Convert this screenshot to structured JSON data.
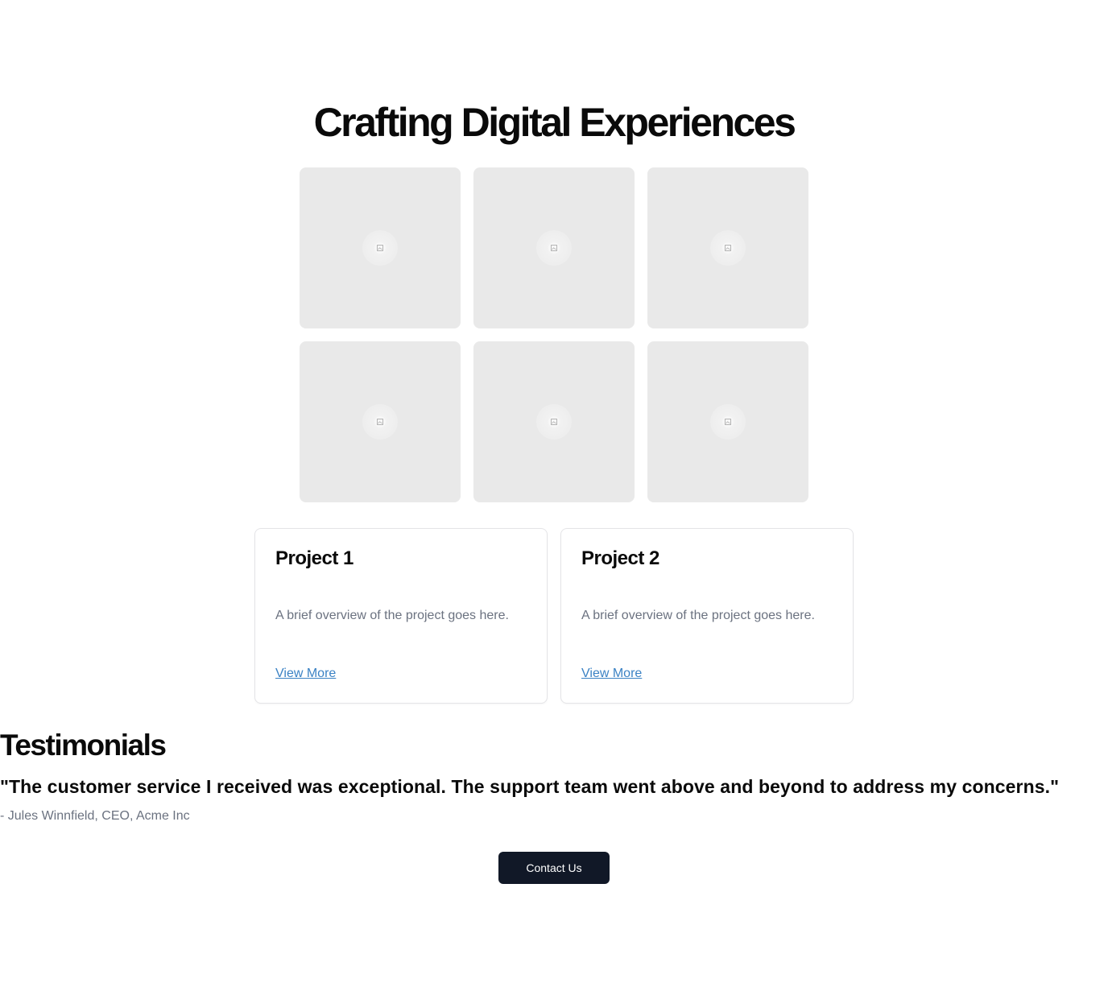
{
  "hero": {
    "title": "Crafting Digital Experiences"
  },
  "gallery": {
    "image_icon": "image-placeholder-icon",
    "tile_color": "#e9e9e9",
    "tile_count": 6
  },
  "projects": [
    {
      "title": "Project 1",
      "description": "A brief overview of the project goes here.",
      "link_label": "View More"
    },
    {
      "title": "Project 2",
      "description": "A brief overview of the project goes here.",
      "link_label": "View More"
    }
  ],
  "testimonials": {
    "title": "Testimonials",
    "quote": "\"The customer service I received was exceptional. The support team went above and beyond to address my concerns.\"",
    "author": "- Jules Winnfield, CEO, Acme Inc"
  },
  "contact": {
    "button_label": "Contact Us",
    "button_color": "#111827"
  },
  "colors": {
    "link": "#3b82c4",
    "muted_text": "#6b7280"
  }
}
